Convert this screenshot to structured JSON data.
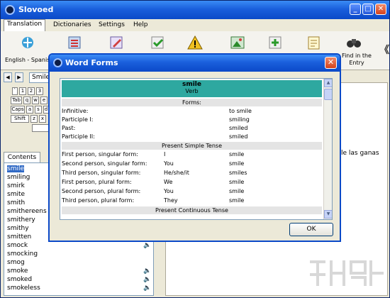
{
  "app": {
    "title": "Slovoed"
  },
  "menu": [
    "Translation",
    "Dictionaries",
    "Settings",
    "Help"
  ],
  "toolbar": {
    "language_label": "English - Spanish",
    "find_label_1": "Find in the",
    "find_label_2": "Entry",
    "chevron": "《"
  },
  "search": {
    "value": "Smile"
  },
  "keyboard": {
    "row1": [
      "`",
      "1",
      "2",
      "3"
    ],
    "row2": [
      "Tab",
      "q",
      "w",
      "e"
    ],
    "row3": [
      "Caps",
      "a",
      "s",
      "d"
    ],
    "row4": [
      "Shift",
      "z",
      "x"
    ]
  },
  "contents_tab": "Contents",
  "word_list": [
    "smile",
    "smiling",
    "smirk",
    "smite",
    "smith",
    "smithereens",
    "smithery",
    "smithy",
    "smitten",
    "smock",
    "smocking",
    "smog",
    "smoke",
    "smoked",
    "smokeless"
  ],
  "right_pane_text": "le las ganas",
  "dialog": {
    "title": "Word Forms",
    "word": "smile",
    "pos": "Verb",
    "forms_header": "Forms:",
    "forms": [
      {
        "label": "Infinitive:",
        "value": "to smile"
      },
      {
        "label": "Participle I:",
        "value": "smiling"
      },
      {
        "label": "Past:",
        "value": "smiled"
      },
      {
        "label": "Participle II:",
        "value": "smiled"
      }
    ],
    "present_simple_header": "Present Simple Tense",
    "present_simple": [
      {
        "label": "First person, singular form:",
        "pronoun": "I",
        "value": "smile"
      },
      {
        "label": "Second person, singular form:",
        "pronoun": "You",
        "value": "smile"
      },
      {
        "label": "Third person, singular form:",
        "pronoun": "He/she/it",
        "value": "smiles"
      },
      {
        "label": "First person, plural form:",
        "pronoun": "We",
        "value": "smile"
      },
      {
        "label": "Second person, plural form:",
        "pronoun": "You",
        "value": "smile"
      },
      {
        "label": "Third person, plural form:",
        "pronoun": "They",
        "value": "smile"
      }
    ],
    "present_continuous_header": "Present Continuous Tense",
    "ok_label": "OK"
  },
  "colors": {
    "titlebar": "#0b49c8",
    "header_teal": "#2ea8a0",
    "selection": "#316ac5"
  }
}
